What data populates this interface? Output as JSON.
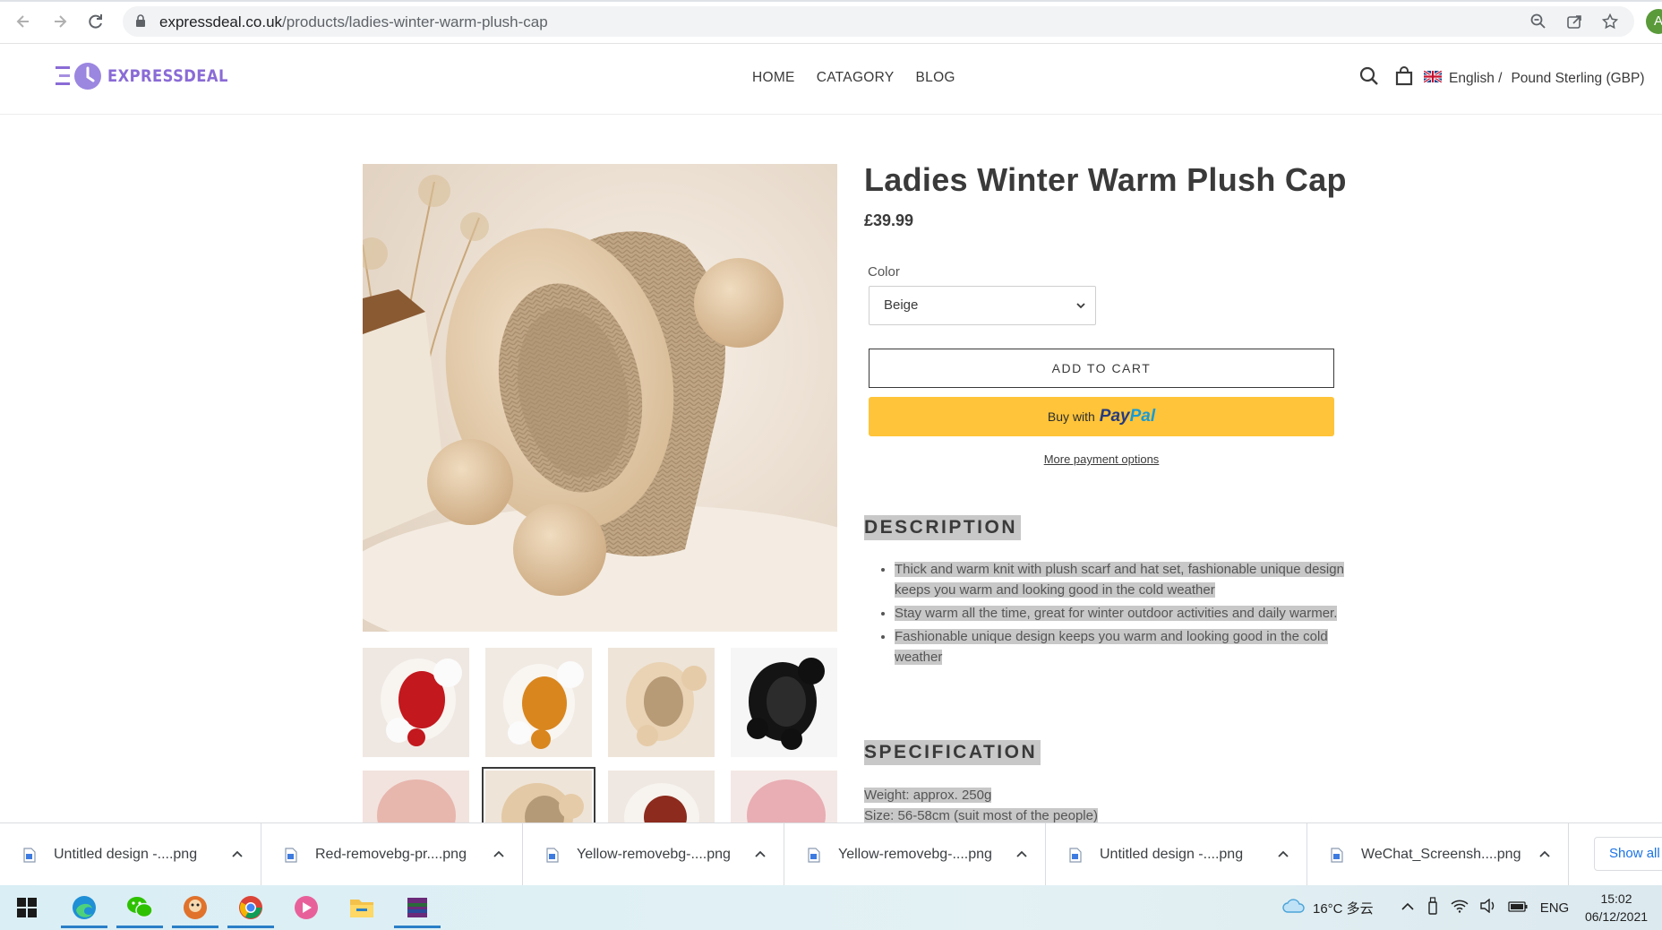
{
  "browser": {
    "url_domain": "expressdeal.co.uk",
    "url_path": "/products/ladies-winter-warm-plush-cap",
    "profile_initial": "A"
  },
  "header": {
    "logo_text": "EXPRESSDEAL",
    "nav": [
      "HOME",
      "CATAGORY",
      "BLOG"
    ],
    "language": "English",
    "currency": "Pound Sterling (GBP)"
  },
  "product": {
    "title": "Ladies Winter Warm Plush Cap",
    "price": "£39.99",
    "color_label": "Color",
    "color_value": "Beige",
    "add_to_cart": "ADD TO CART",
    "paypal_prefix": "Buy with",
    "paypal_brand_1": "Pay",
    "paypal_brand_2": "Pal",
    "more_payment": "More payment options",
    "description_heading": "DESCRIPTION",
    "description_items": [
      "Thick and warm knit with plush scarf and hat set, fashionable unique design keeps you warm and looking good in the cold weather",
      "Stay warm all the time, great for winter outdoor activities and daily warmer.",
      "Fashionable unique design keeps you warm and looking good in the cold weather"
    ],
    "specification_heading": "SPECIFICATION",
    "spec_lines": [
      "Weight: approx. 250g",
      "Size: 56-58cm (suit most of the people)"
    ],
    "thumbnail_colors": [
      "red",
      "orange",
      "beige",
      "black",
      "pink",
      "beige",
      "red",
      "pink"
    ],
    "selected_thumbnail": 5
  },
  "downloads": {
    "items": [
      "Untitled design -....png",
      "Red-removebg-pr....png",
      "Yellow-removebg-....png",
      "Yellow-removebg-....png",
      "Untitled design -....png",
      "WeChat_Screensh....png"
    ],
    "show_all": "Show all"
  },
  "taskbar": {
    "weather": "16°C 多云",
    "language": "ENG",
    "time": "15:02",
    "date": "06/12/2021"
  }
}
